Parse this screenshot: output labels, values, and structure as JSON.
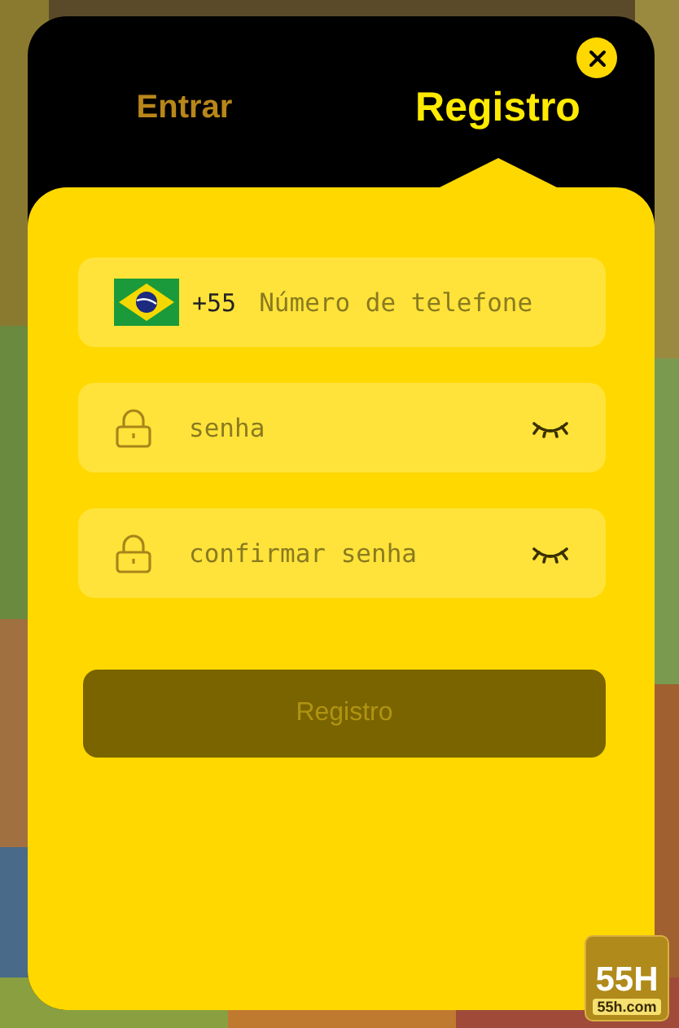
{
  "tabs": [
    {
      "label": "Entrar",
      "selected": false
    },
    {
      "label": "Registro",
      "selected": true
    }
  ],
  "form": {
    "phone": {
      "country_code": "+55",
      "placeholder": "Número de telefone"
    },
    "fields": [
      {
        "kind": "password",
        "placeholder": "senha"
      },
      {
        "kind": "password",
        "placeholder": "confirmar senha"
      }
    ],
    "submit": {
      "label": "Registro",
      "disabled": true
    }
  },
  "badge": {
    "title": "55H",
    "site": "55h.com"
  }
}
